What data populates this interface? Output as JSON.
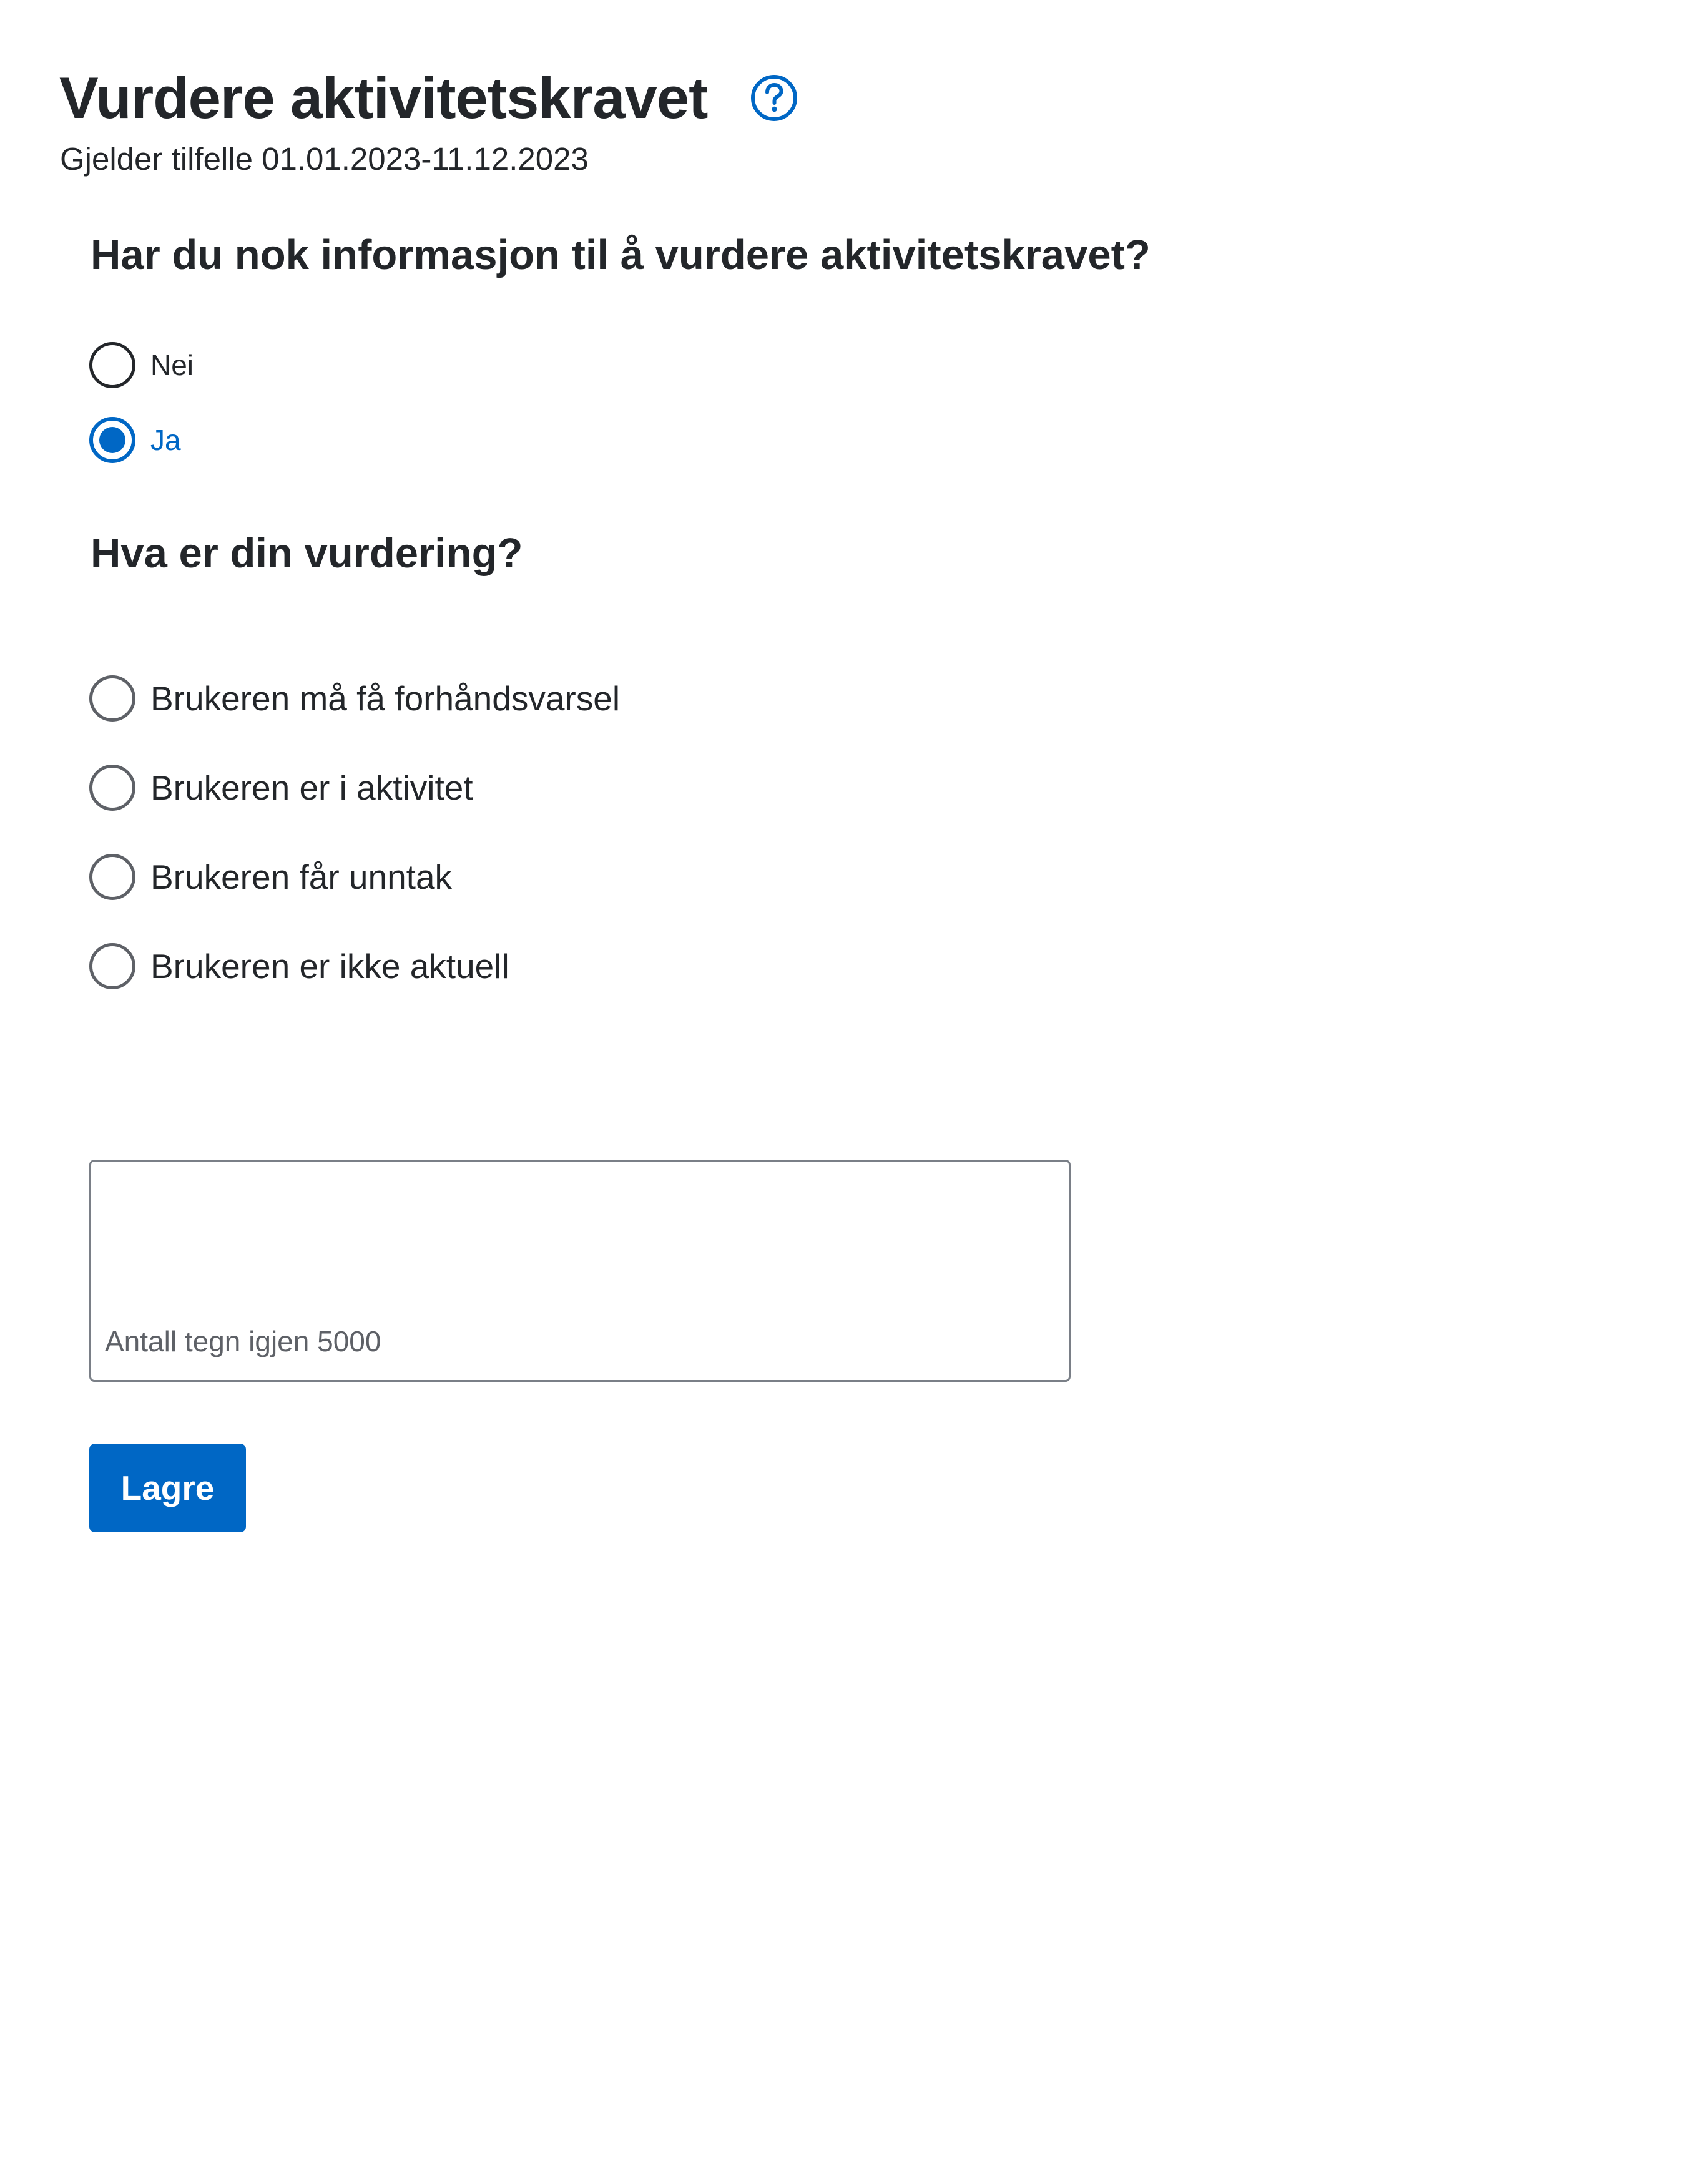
{
  "header": {
    "title": "Vurdere aktivitetskravet",
    "help_icon": "question-circle-icon",
    "subtitle": "Gjelder tilfelle 01.01.2023-11.12.2023"
  },
  "info_question": {
    "label": "Har du nok informasjon til å vurdere aktivitetskravet?",
    "options": [
      {
        "label": "Nei",
        "checked": false
      },
      {
        "label": "Ja",
        "checked": true
      }
    ]
  },
  "assessment_question": {
    "label": "Hva er din vurdering?",
    "options": [
      {
        "label": "Brukeren må få forhåndsvarsel",
        "checked": false
      },
      {
        "label": "Brukeren er i aktivitet",
        "checked": false
      },
      {
        "label": "Brukeren får unntak",
        "checked": false
      },
      {
        "label": "Brukeren er ikke aktuell",
        "checked": false
      }
    ]
  },
  "comment": {
    "value": "",
    "char_count_text": "Antall tegn igjen 5000"
  },
  "actions": {
    "save_label": "Lagre"
  },
  "colors": {
    "accent": "#0067c5",
    "text": "#23262a",
    "border": "#5e6167"
  }
}
